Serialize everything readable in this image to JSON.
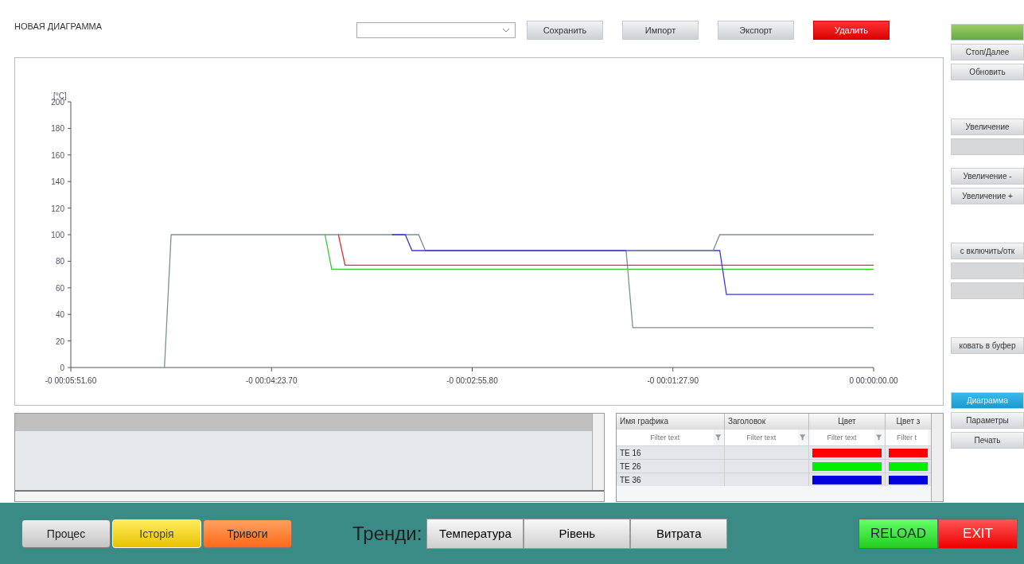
{
  "header": {
    "title": "НОВАЯ ДИАГРАММА",
    "buttons": [
      {
        "label": "Сохранить",
        "kind": "plain"
      },
      {
        "label": "Импорт",
        "kind": "plain"
      },
      {
        "label": "Экспорт",
        "kind": "plain"
      },
      {
        "label": "Удалить",
        "kind": "danger"
      }
    ]
  },
  "chart": {
    "chart_data": {
      "type": "line",
      "ylabel": "[°C]",
      "ylim": [
        0,
        200
      ],
      "yticks": [
        0,
        20,
        40,
        60,
        80,
        100,
        120,
        140,
        160,
        180,
        200
      ],
      "categories": [
        "-0 00:05:51.60",
        null,
        null,
        null,
        null,
        null,
        null,
        null,
        null,
        null,
        null,
        null,
        null,
        null,
        null,
        null,
        null,
        null,
        null,
        null,
        null,
        null,
        null,
        null,
        null,
        null,
        null,
        null,
        null,
        null,
        "-0 00:04:23.70",
        null,
        null,
        null,
        null,
        null,
        null,
        null,
        null,
        null,
        null,
        null,
        null,
        null,
        null,
        null,
        null,
        null,
        null,
        null,
        null,
        null,
        null,
        null,
        null,
        null,
        null,
        null,
        null,
        null,
        "-0 00:02:55.80",
        null,
        null,
        null,
        null,
        null,
        null,
        null,
        null,
        null,
        null,
        null,
        null,
        null,
        null,
        null,
        null,
        null,
        null,
        null,
        null,
        null,
        null,
        null,
        null,
        null,
        null,
        null,
        null,
        null,
        "-0 00:01:27.90",
        null,
        null,
        null,
        null,
        null,
        null,
        null,
        null,
        null,
        null,
        null,
        null,
        null,
        null,
        null,
        null,
        null,
        null,
        null,
        null,
        null,
        null,
        null,
        null,
        null,
        null,
        null,
        null,
        null,
        "0 00:00:00.00"
      ],
      "series": [
        {
          "color": "#7f9090",
          "values": [
            null,
            null,
            null,
            null,
            null,
            null,
            null,
            null,
            null,
            null,
            null,
            null,
            null,
            null,
            0,
            100,
            100,
            100,
            100,
            100,
            100,
            100,
            100,
            100,
            100,
            100,
            100,
            100,
            100,
            100,
            100,
            100,
            100,
            100,
            100,
            100,
            100,
            100,
            100,
            100,
            100,
            100,
            100,
            100,
            100,
            100,
            100,
            100,
            100,
            100,
            100,
            100,
            100,
            88,
            88,
            88,
            88,
            88,
            88,
            88,
            88,
            88,
            88,
            88,
            88,
            88,
            88,
            88,
            88,
            88,
            88,
            88,
            88,
            88,
            88,
            88,
            88,
            88,
            88,
            88,
            88,
            88,
            88,
            88,
            30,
            30,
            30,
            30,
            30,
            30,
            30,
            30,
            30,
            30,
            30,
            30,
            30,
            30,
            30,
            30,
            30,
            30,
            30,
            30,
            30,
            30,
            30,
            30,
            30,
            30,
            30,
            30,
            30,
            30,
            30,
            30,
            30,
            30,
            30,
            30,
            30
          ]
        },
        {
          "color": "#33cc33",
          "values": [
            null,
            null,
            null,
            null,
            null,
            null,
            null,
            null,
            null,
            null,
            null,
            null,
            null,
            null,
            null,
            null,
            null,
            null,
            null,
            null,
            null,
            null,
            null,
            null,
            null,
            null,
            null,
            null,
            null,
            null,
            null,
            null,
            null,
            null,
            null,
            null,
            null,
            null,
            100,
            74,
            74,
            74,
            74,
            74,
            74,
            74,
            74,
            74,
            74,
            74,
            74,
            74,
            74,
            74,
            74,
            74,
            74,
            74,
            74,
            74,
            74,
            74,
            74,
            74,
            74,
            74,
            74,
            74,
            74,
            74,
            74,
            74,
            74,
            74,
            74,
            74,
            74,
            74,
            74,
            74,
            74,
            74,
            74,
            74,
            74,
            74,
            74,
            74,
            74,
            74,
            74,
            74,
            74,
            74,
            74,
            74,
            74,
            74,
            74,
            74,
            74,
            74,
            74,
            74,
            74,
            74,
            74,
            74,
            74,
            74,
            74,
            74,
            74,
            74,
            74,
            74,
            74,
            74,
            74,
            74,
            74
          ]
        },
        {
          "color": "#e03030",
          "values": [
            null,
            null,
            null,
            null,
            null,
            null,
            null,
            null,
            null,
            null,
            null,
            null,
            null,
            null,
            null,
            null,
            null,
            null,
            null,
            null,
            null,
            null,
            null,
            null,
            null,
            null,
            null,
            null,
            null,
            null,
            null,
            null,
            null,
            null,
            null,
            null,
            null,
            null,
            null,
            null,
            100,
            77,
            77,
            77,
            77,
            77,
            77,
            77,
            77,
            77,
            77,
            77,
            77,
            77,
            77,
            77,
            77,
            77,
            77,
            77,
            77,
            77,
            77,
            77,
            77,
            77,
            77,
            77,
            77,
            77,
            77,
            77,
            77,
            77,
            77,
            77,
            77,
            77,
            77,
            77,
            77,
            77,
            77,
            77,
            77,
            77,
            77,
            77,
            77,
            77,
            77,
            77,
            77,
            77,
            77,
            77,
            77,
            77,
            77,
            77,
            77,
            77,
            77,
            77,
            77,
            77,
            77,
            77,
            77,
            77,
            77,
            77,
            77,
            77,
            77,
            77,
            77,
            77,
            77,
            77,
            77
          ]
        },
        {
          "color": "#3a3adb",
          "values": [
            null,
            null,
            null,
            null,
            null,
            null,
            null,
            null,
            null,
            null,
            null,
            null,
            null,
            null,
            null,
            null,
            null,
            null,
            null,
            null,
            null,
            null,
            null,
            null,
            null,
            null,
            null,
            null,
            null,
            null,
            null,
            null,
            null,
            null,
            null,
            null,
            null,
            null,
            null,
            null,
            null,
            null,
            null,
            null,
            null,
            null,
            null,
            null,
            100,
            100,
            100,
            88,
            88,
            88,
            88,
            88,
            88,
            88,
            88,
            88,
            88,
            88,
            88,
            88,
            88,
            88,
            88,
            88,
            88,
            88,
            88,
            88,
            88,
            88,
            88,
            88,
            88,
            88,
            88,
            88,
            88,
            88,
            88,
            88,
            88,
            88,
            88,
            88,
            88,
            88,
            88,
            88,
            88,
            88,
            88,
            88,
            88,
            88,
            55,
            55,
            55,
            55,
            55,
            55,
            55,
            55,
            55,
            55,
            55,
            55,
            55,
            55,
            55,
            55,
            55,
            55,
            55,
            55,
            55,
            55,
            55
          ]
        },
        {
          "color": "#7f9090",
          "values": [
            null,
            null,
            null,
            null,
            null,
            null,
            null,
            null,
            null,
            null,
            null,
            null,
            null,
            null,
            null,
            null,
            null,
            null,
            null,
            null,
            null,
            null,
            null,
            null,
            null,
            null,
            null,
            null,
            null,
            null,
            null,
            null,
            null,
            null,
            null,
            null,
            null,
            null,
            null,
            null,
            null,
            null,
            null,
            null,
            null,
            null,
            null,
            null,
            null,
            null,
            null,
            null,
            null,
            null,
            null,
            null,
            null,
            null,
            null,
            null,
            null,
            null,
            null,
            null,
            null,
            null,
            null,
            null,
            null,
            null,
            null,
            null,
            null,
            null,
            null,
            null,
            null,
            null,
            null,
            null,
            null,
            null,
            null,
            88,
            88,
            88,
            88,
            88,
            88,
            88,
            88,
            88,
            88,
            88,
            88,
            88,
            88,
            100,
            100,
            100,
            100,
            100,
            100,
            100,
            100,
            100,
            100,
            100,
            100,
            100,
            100,
            100,
            100,
            100,
            100,
            100,
            100,
            100,
            100,
            100,
            100
          ]
        }
      ]
    }
  },
  "graph_table": {
    "columns": [
      "Имя графика",
      "Заголовок",
      "Цвет",
      "Цвет з"
    ],
    "filters": [
      {
        "placeholder": "Filter text"
      },
      {
        "placeholder": "Filter text"
      },
      {
        "placeholder": "Filter text"
      },
      {
        "placeholder": "Filter t"
      }
    ],
    "rows": [
      {
        "name": "TE 16",
        "color": "#ff0000"
      },
      {
        "name": "TE 26",
        "color": "#00ee00"
      },
      {
        "name": "TE 36",
        "color": "#0000dd"
      }
    ]
  },
  "side_buttons": [
    {
      "kind": "green",
      "disabled": false,
      "selected": false
    },
    {
      "label": "Стоп/Далее",
      "kind": "plain",
      "disabled": false,
      "selected": false
    },
    {
      "label": "Обновить",
      "kind": "plain",
      "disabled": false,
      "selected": false
    },
    {
      "kind": "gap"
    },
    {
      "label": "Увеличение",
      "kind": "plain",
      "disabled": false,
      "selected": false
    },
    {
      "kind": "plain",
      "disabled": true,
      "selected": false
    },
    {
      "kind": "space"
    },
    {
      "label": "Увеличение -",
      "kind": "plain",
      "disabled": false,
      "selected": false
    },
    {
      "label": "Увеличение +",
      "kind": "plain",
      "disabled": false,
      "selected": false
    },
    {
      "kind": "gap"
    },
    {
      "label": "с включить/отк",
      "kind": "plain",
      "disabled": false,
      "selected": false
    },
    {
      "kind": "plain",
      "disabled": true,
      "selected": false
    },
    {
      "kind": "plain",
      "disabled": true,
      "selected": false
    },
    {
      "kind": "gap"
    },
    {
      "label": "ковать в буфер",
      "kind": "plain",
      "disabled": false,
      "selected": false
    },
    {
      "kind": "gap"
    },
    {
      "label": "Диаграмма",
      "kind": "plain",
      "disabled": false,
      "selected": true
    },
    {
      "label": "Параметры",
      "kind": "plain",
      "disabled": false,
      "selected": false
    },
    {
      "label": "Печать",
      "kind": "plain",
      "disabled": false,
      "selected": false
    }
  ],
  "nav": {
    "buttons": [
      {
        "label": "Процес",
        "kind": "grey",
        "selected": false
      },
      {
        "label": "Історія",
        "kind": "yellow",
        "selected": true
      },
      {
        "label": "Тривоги",
        "kind": "orange",
        "selected": false
      }
    ],
    "trends_label": "Тренди:",
    "trends": [
      {
        "label": "Температура"
      },
      {
        "label": "Рівень"
      },
      {
        "label": "Витрата"
      }
    ],
    "actions": [
      {
        "label": "RELOAD",
        "kind": "green"
      },
      {
        "label": "EXIT",
        "kind": "red"
      }
    ]
  }
}
